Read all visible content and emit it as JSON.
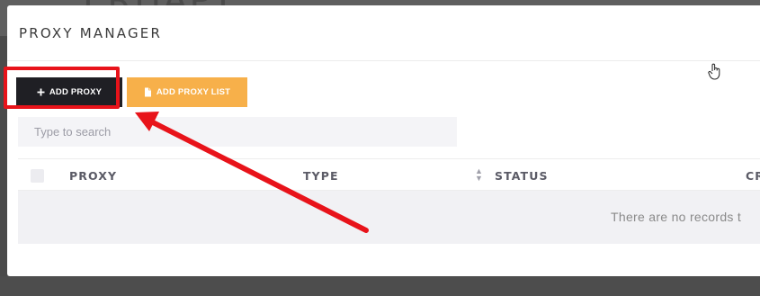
{
  "backdrop": {
    "partial_text": "ERHAPY"
  },
  "modal": {
    "title": "PROXY MANAGER"
  },
  "toolbar": {
    "add_proxy_label": "ADD PROXY",
    "add_proxy_list_label": "ADD PROXY LIST"
  },
  "search": {
    "placeholder": "Type to search",
    "value": ""
  },
  "table": {
    "columns": [
      "PROXY",
      "TYPE",
      "STATUS",
      "CR"
    ],
    "empty_message": "There are no records t"
  },
  "annotation": {
    "highlight_color": "#e8131a",
    "arrow_color": "#e8131a"
  },
  "colors": {
    "add_button": "#1f1f24",
    "add_list_button": "#f7b04a"
  },
  "icons": [
    "plus-icon",
    "file-icon",
    "sort-icon",
    "hand-cursor-icon",
    "arrow-icon"
  ]
}
